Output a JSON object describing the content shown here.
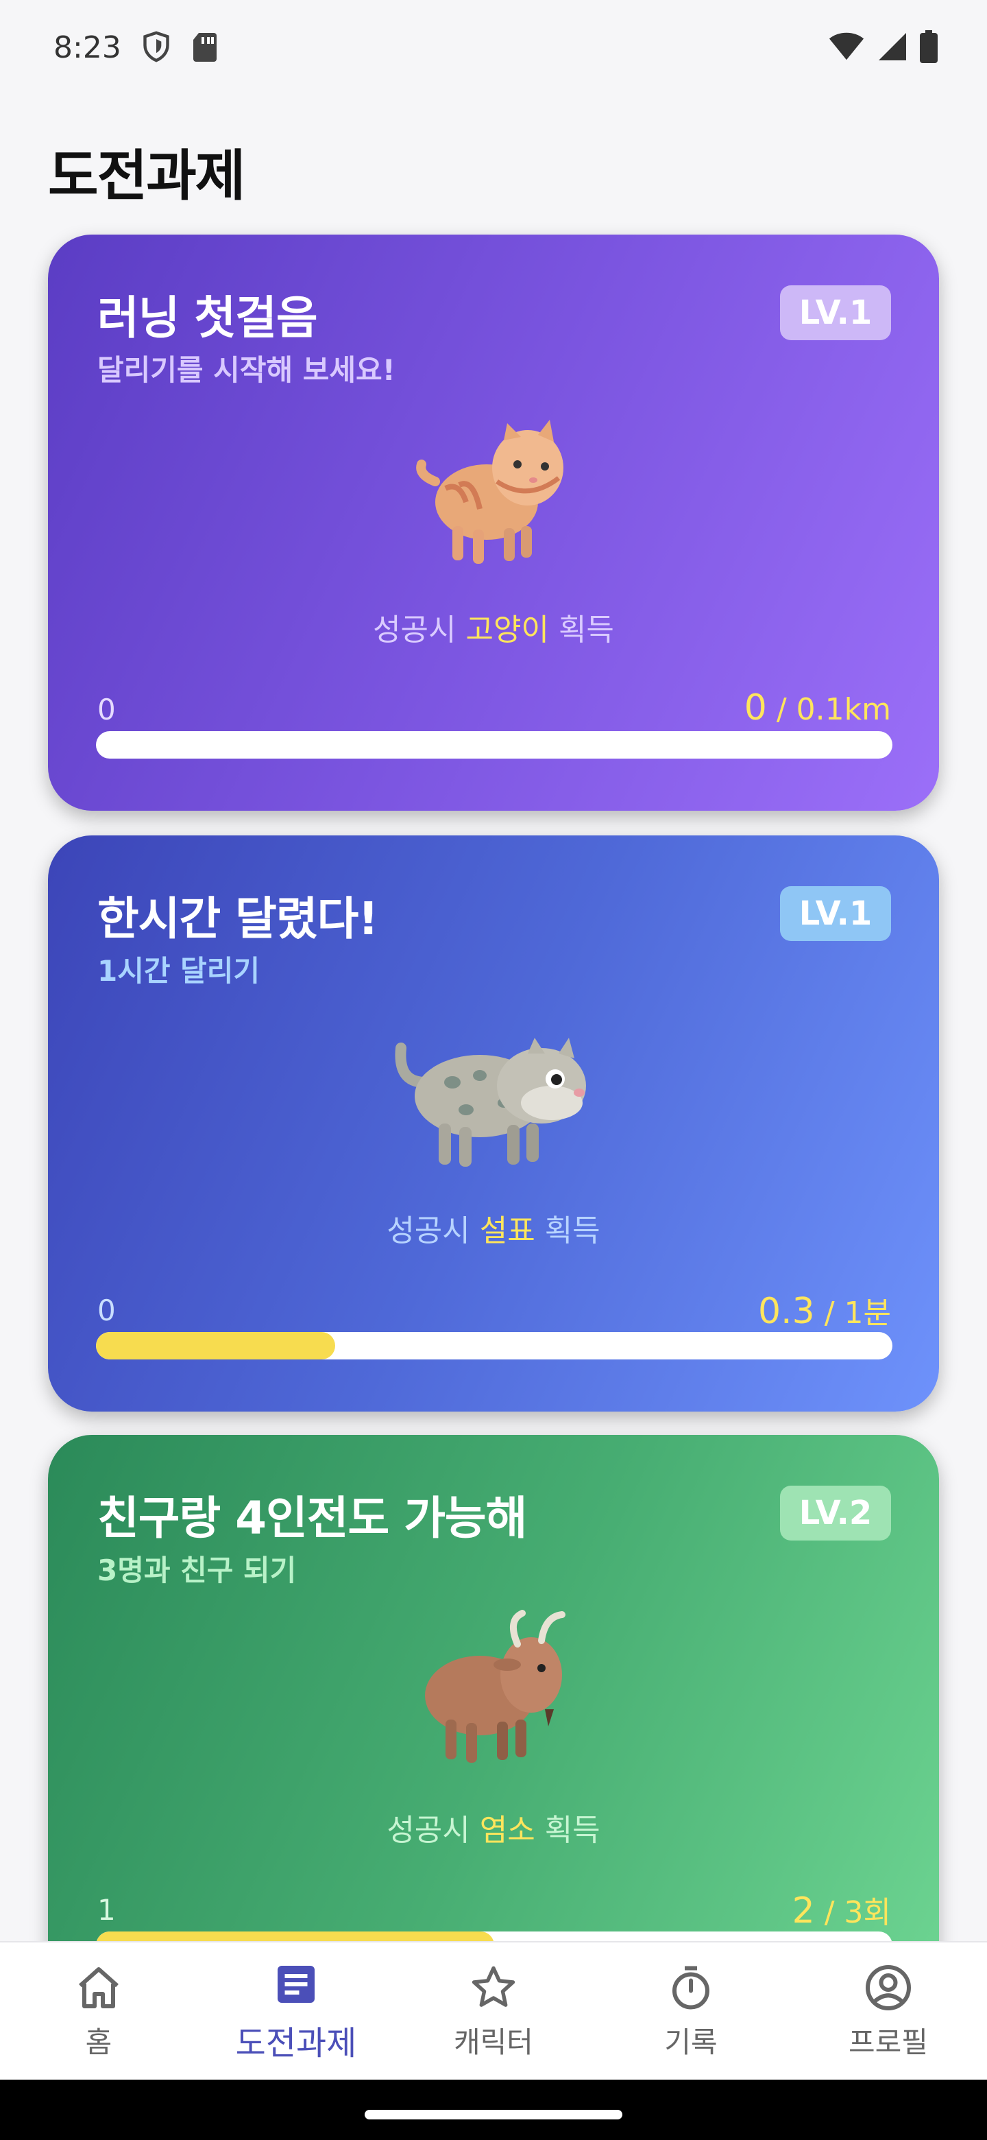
{
  "status_bar": {
    "time": "8:23",
    "icons": [
      "shield-icon",
      "sd-card-icon",
      "wifi-icon",
      "signal-icon",
      "battery-icon"
    ]
  },
  "page_title": "도전과제",
  "challenges": [
    {
      "title": "러닝 첫걸음",
      "subtitle": "달리기를 시작해 보세요!",
      "level": "LV.1",
      "reward_prefix": "성공시 ",
      "reward_name": "고양이",
      "reward_suffix": " 획득",
      "progress_start": "0",
      "progress_current": "0",
      "progress_slash": " / ",
      "progress_target": "0.1km",
      "progress_fraction": 0.0,
      "animal": "cat-icon"
    },
    {
      "title": "한시간 달렸다!",
      "subtitle": "1시간 달리기",
      "level": "LV.1",
      "reward_prefix": "성공시 ",
      "reward_name": "설표",
      "reward_suffix": " 획득",
      "progress_start": "0",
      "progress_current": "0.3",
      "progress_slash": " / ",
      "progress_target": "1분",
      "progress_fraction": 0.3,
      "animal": "snow-leopard-icon"
    },
    {
      "title": "친구랑 4인전도 가능해",
      "subtitle": "3명과 친구 되기",
      "level": "LV.2",
      "reward_prefix": "성공시 ",
      "reward_name": "염소",
      "reward_suffix": " 획득",
      "progress_start": "1",
      "progress_current": "2",
      "progress_slash": " / ",
      "progress_target": "3회",
      "progress_fraction": 0.5,
      "animal": "goat-icon"
    }
  ],
  "bottom_nav": [
    {
      "label": "홈",
      "icon": "home-icon",
      "active": false
    },
    {
      "label": "도전과제",
      "icon": "document-icon",
      "active": true
    },
    {
      "label": "캐릭터",
      "icon": "star-icon",
      "active": false
    },
    {
      "label": "기록",
      "icon": "timer-icon",
      "active": false
    },
    {
      "label": "프로필",
      "icon": "profile-icon",
      "active": false
    }
  ],
  "colors": {
    "accent": "#4b4fb8",
    "highlight": "#ffe55c",
    "progress_fill": "#f7dc4f"
  }
}
